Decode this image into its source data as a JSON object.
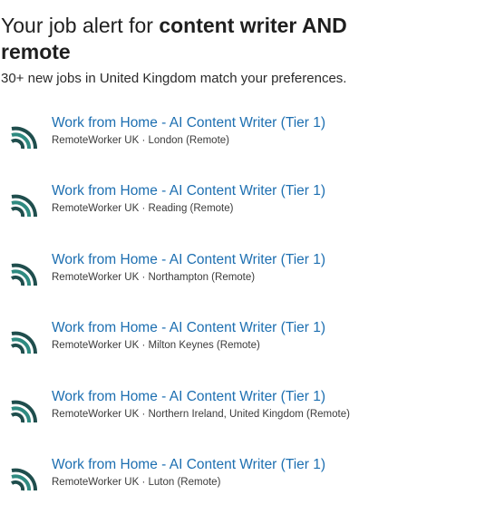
{
  "header": {
    "title_prefix": "Your job alert for ",
    "title_query": "content writer AND remote",
    "subtitle": "30+ new jobs in United Kingdom match your preferences."
  },
  "colors": {
    "link": "#1d6fb1",
    "logo_dark": "#1f4e4d",
    "logo_light": "#2e8a80"
  },
  "logo_icon": "remoteworker-signal-icon",
  "jobs": [
    {
      "title": "Work from Home - AI Content Writer (Tier 1)",
      "company": "RemoteWorker UK",
      "location": "London (Remote)",
      "meta": "RemoteWorker UK · London (Remote)"
    },
    {
      "title": "Work from Home - AI Content Writer (Tier 1)",
      "company": "RemoteWorker UK",
      "location": "Reading (Remote)",
      "meta": "RemoteWorker UK · Reading (Remote)"
    },
    {
      "title": "Work from Home - AI Content Writer (Tier 1)",
      "company": "RemoteWorker UK",
      "location": "Northampton (Remote)",
      "meta": "RemoteWorker UK · Northampton (Remote)"
    },
    {
      "title": "Work from Home - AI Content Writer (Tier 1)",
      "company": "RemoteWorker UK",
      "location": "Milton Keynes (Remote)",
      "meta": "RemoteWorker UK · Milton Keynes (Remote)"
    },
    {
      "title": "Work from Home - AI Content Writer (Tier 1)",
      "company": "RemoteWorker UK",
      "location": "Northern Ireland, United Kingdom (Remote)",
      "meta": "RemoteWorker UK · Northern Ireland, United Kingdom (Remote)"
    },
    {
      "title": "Work from Home - AI Content Writer (Tier 1)",
      "company": "RemoteWorker UK",
      "location": "Luton (Remote)",
      "meta": "RemoteWorker UK · Luton (Remote)"
    }
  ]
}
